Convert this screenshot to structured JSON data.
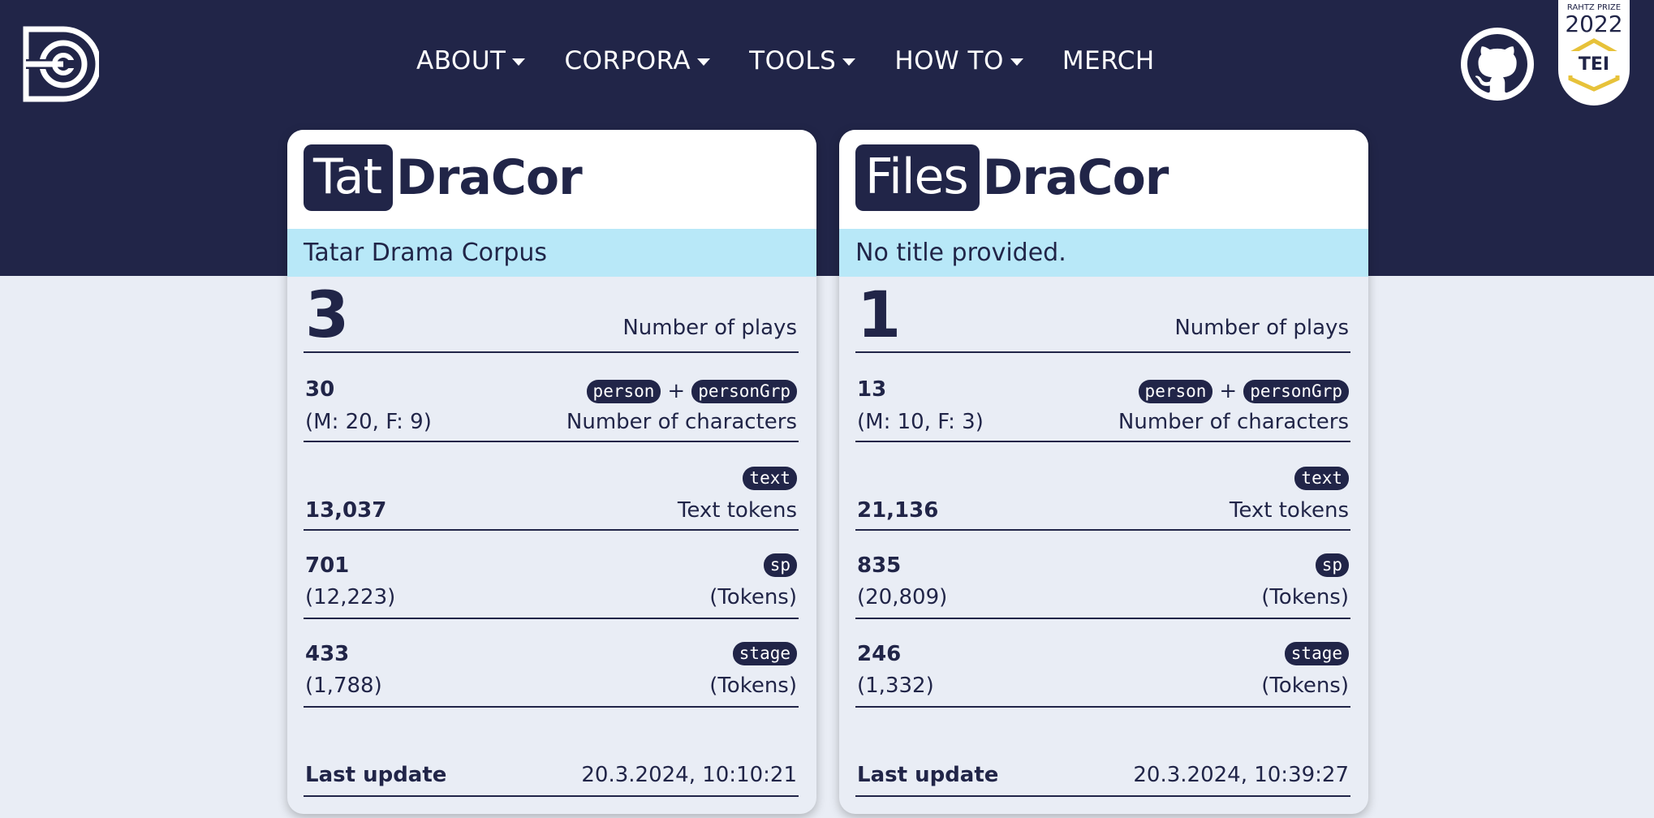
{
  "nav": {
    "items": [
      {
        "label": "ABOUT",
        "dropdown": true
      },
      {
        "label": "CORPORA",
        "dropdown": true
      },
      {
        "label": "TOOLS",
        "dropdown": true
      },
      {
        "label": "HOW TO",
        "dropdown": true
      },
      {
        "label": "MERCH",
        "dropdown": false
      }
    ]
  },
  "badge": {
    "prize": "RAHTZ PRIZE",
    "year": "2022",
    "tei": "TEI"
  },
  "icons": {
    "logo": "dracor-logo",
    "github": "github-icon"
  },
  "colors": {
    "navy": "#212548",
    "subtitle_bg": "#b8e8f8",
    "page_bg": "#e9edf5",
    "tei_gold": "#e7c23a"
  },
  "cards": [
    {
      "prefix": "Tat",
      "suffix": "DraCor",
      "title": "Tatar Drama Corpus",
      "plays": "3",
      "plays_label": "Number of plays",
      "characters": "30",
      "characters_breakdown": "(M: 20, F: 9)",
      "characters_label": "Number of characters",
      "tag_person": "person",
      "tag_plus": "+",
      "tag_persongrp": "personGrp",
      "tag_text": "text",
      "text_tokens": "13,037",
      "text_tokens_label": "Text tokens",
      "tag_sp": "sp",
      "sp_count": "701",
      "sp_tokens": "(12,223)",
      "sp_tokens_label": "(Tokens)",
      "tag_stage": "stage",
      "stage_count": "433",
      "stage_tokens": "(1,788)",
      "stage_tokens_label": "(Tokens)",
      "last_update_label": "Last update",
      "last_update": "20.3.2024, 10:10:21"
    },
    {
      "prefix": "Files",
      "suffix": "DraCor",
      "title": "No title provided.",
      "plays": "1",
      "plays_label": "Number of plays",
      "characters": "13",
      "characters_breakdown": "(M: 10, F: 3)",
      "characters_label": "Number of characters",
      "tag_person": "person",
      "tag_plus": "+",
      "tag_persongrp": "personGrp",
      "tag_text": "text",
      "text_tokens": "21,136",
      "text_tokens_label": "Text tokens",
      "tag_sp": "sp",
      "sp_count": "835",
      "sp_tokens": "(20,809)",
      "sp_tokens_label": "(Tokens)",
      "tag_stage": "stage",
      "stage_count": "246",
      "stage_tokens": "(1,332)",
      "stage_tokens_label": "(Tokens)",
      "last_update_label": "Last update",
      "last_update": "20.3.2024, 10:39:27"
    }
  ]
}
